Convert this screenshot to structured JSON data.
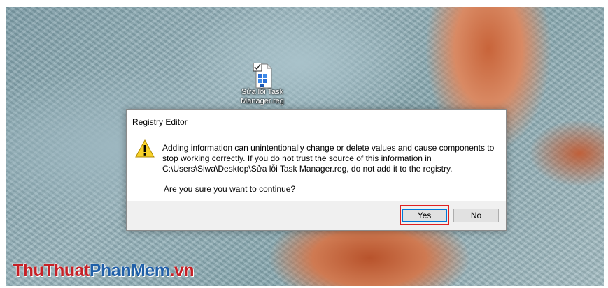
{
  "desktop": {
    "file_icon": "registry-file-icon",
    "file_label_line1": "Sửa lỗi Task",
    "file_label_line2": "Manager.reg"
  },
  "dialog": {
    "title": "Registry Editor",
    "icon": "warning-icon",
    "message_line1": "Adding information can unintentionally change or delete values and cause components to",
    "message_line2": "stop working correctly. If you do not trust the source of this information in",
    "message_line3": "C:\\Users\\Siwa\\Desktop\\Sửa lỗi Task Manager.reg, do not add it to the registry.",
    "question": "Are you sure you want to continue?",
    "buttons": {
      "yes": "Yes",
      "no": "No"
    }
  },
  "watermark": {
    "part1": "ThuThuat",
    "part2": "PhanMem",
    "part3": ".vn"
  },
  "colors": {
    "highlight": "#e02020",
    "warning_yellow": "#f8d22a",
    "button_focus": "#0078d7"
  }
}
